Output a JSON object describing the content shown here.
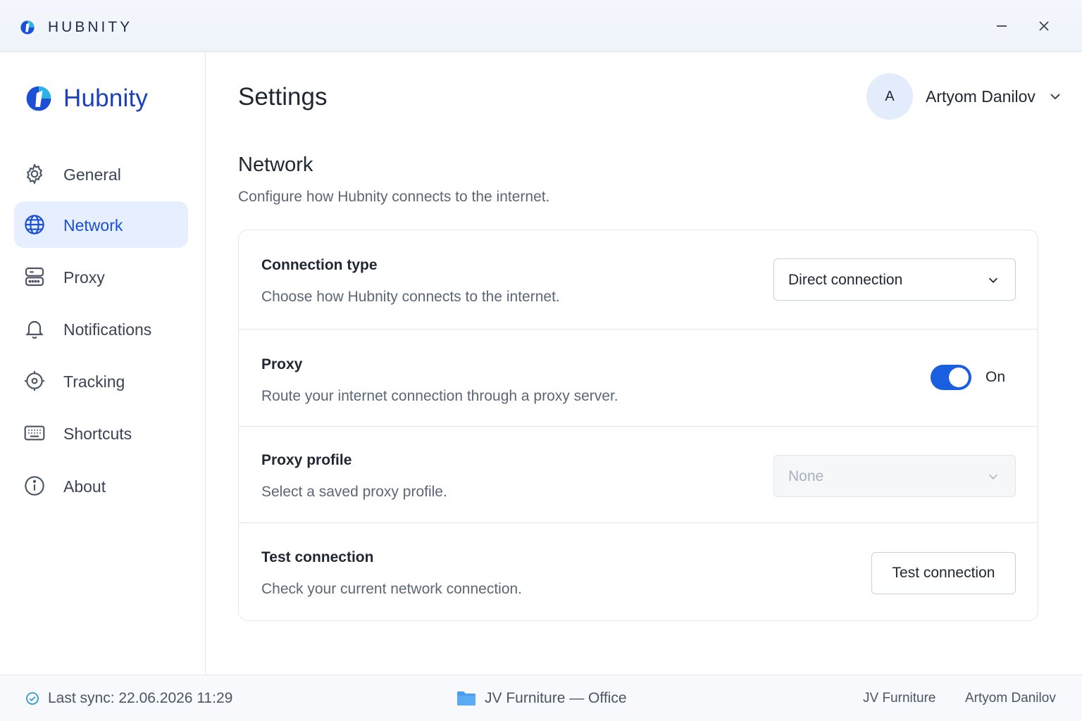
{
  "window": {
    "title": "HUBNITY",
    "minimize_icon": "minimize-icon",
    "close_icon": "close-icon"
  },
  "sidebar": {
    "brand": "Hubnity",
    "items": [
      {
        "label": "General",
        "icon": "gear-icon",
        "active": false
      },
      {
        "label": "Network",
        "icon": "globe-icon",
        "active": true
      },
      {
        "label": "Proxy",
        "icon": "server-icon",
        "active": false
      },
      {
        "label": "Notifications",
        "icon": "bell-icon",
        "active": false
      },
      {
        "label": "Tracking",
        "icon": "crosshair-icon",
        "active": false
      },
      {
        "label": "Shortcuts",
        "icon": "keyboard-icon",
        "active": false
      },
      {
        "label": "About",
        "icon": "info-icon",
        "active": false
      }
    ]
  },
  "header": {
    "title": "Settings",
    "user": {
      "initial": "A",
      "name": "Artyom Danilov"
    }
  },
  "section": {
    "title": "Network",
    "description": "Configure how Hubnity connects to the internet."
  },
  "settings": {
    "connection_type": {
      "title": "Connection type",
      "description": "Choose how Hubnity connects to the internet.",
      "value": "Direct connection"
    },
    "proxy": {
      "title": "Proxy",
      "description": "Route your internet connection through a proxy server.",
      "enabled": true,
      "state_label": "On"
    },
    "proxy_profile": {
      "title": "Proxy profile",
      "description": "Select a saved proxy profile.",
      "value": "None",
      "disabled": true
    },
    "test_connection": {
      "title": "Test connection",
      "description": "Check your current network connection.",
      "button_label": "Test connection"
    }
  },
  "statusbar": {
    "sync": "Last sync: 22.06.2026 11:29",
    "workspace": "JV Furniture — Office",
    "company": "JV Furniture",
    "user": "Artyom Danilov"
  },
  "colors": {
    "accent": "#1a5fe0",
    "brand": "#1a3fbf",
    "active_nav_bg": "#e5efff",
    "folder": "#4a9cf0",
    "sync_check": "#2f9ad6"
  }
}
